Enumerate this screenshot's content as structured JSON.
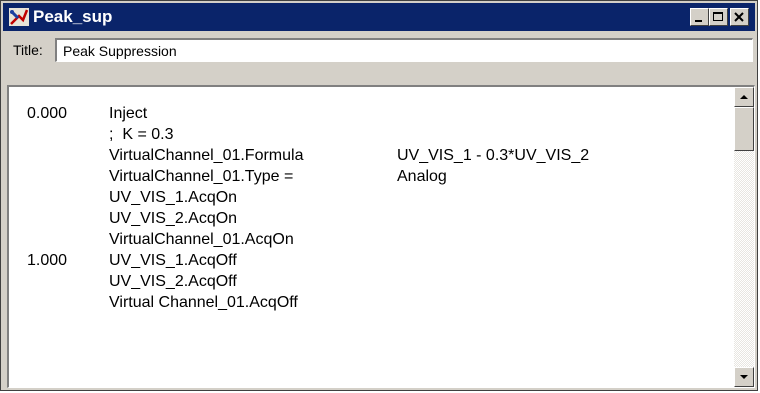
{
  "window": {
    "title": "Peak_sup",
    "app_icon": "method-editor-icon",
    "titlebar_color": "#0a246a"
  },
  "title_field": {
    "label": "Title:",
    "value": "Peak Suppression"
  },
  "program": {
    "lines": [
      {
        "time": "0.000",
        "command": "Inject",
        "value": ""
      },
      {
        "time": "",
        "command": ";  K = 0.3",
        "value": ""
      },
      {
        "time": "",
        "command": "VirtualChannel_01.Formula",
        "value": "UV_VIS_1 - 0.3*UV_VIS_2"
      },
      {
        "time": "",
        "command": "VirtualChannel_01.Type =",
        "value": "Analog"
      },
      {
        "time": "",
        "command": "UV_VIS_1.AcqOn",
        "value": ""
      },
      {
        "time": "",
        "command": "UV_VIS_2.AcqOn",
        "value": ""
      },
      {
        "time": "",
        "command": "VirtualChannel_01.AcqOn",
        "value": ""
      },
      {
        "time": "1.000",
        "command": "UV_VIS_1.AcqOff",
        "value": ""
      },
      {
        "time": "",
        "command": "UV_VIS_2.AcqOff",
        "value": ""
      },
      {
        "time": "",
        "command": "Virtual Channel_01.AcqOff",
        "value": ""
      }
    ]
  },
  "scrollbar": {
    "position": 0
  }
}
